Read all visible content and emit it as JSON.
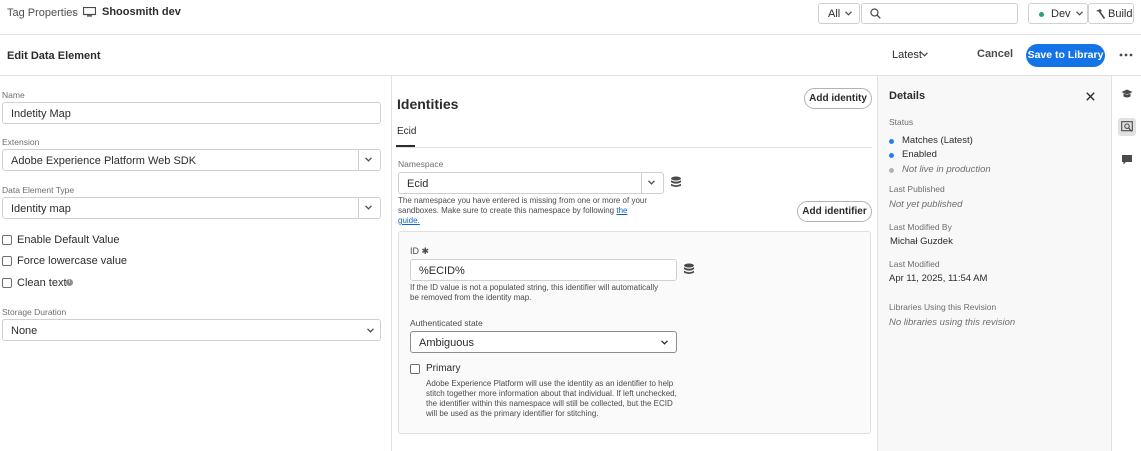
{
  "topbar": {
    "breadcrumb_root": "Tag Properties",
    "breadcrumb_sep": "›",
    "property_name": "Shoosmith dev",
    "scope_value": "All",
    "search_placeholder": "",
    "env_label": "Dev",
    "env_color": "#2d9d78",
    "build_label": "Build"
  },
  "header": {
    "title": "Edit Data Element",
    "version_label": "Latest",
    "cancel_label": "Cancel",
    "save_label": "Save to Library",
    "accent": "#1473e6"
  },
  "left": {
    "name_label": "Name",
    "name_value": "Indetity Map",
    "extension_label": "Extension",
    "extension_value": "Adobe Experience Platform Web SDK",
    "type_label": "Data Element Type",
    "type_value": "Identity map",
    "checkboxes": [
      {
        "label": "Enable Default Value",
        "checked": false
      },
      {
        "label": "Force lowercase value",
        "checked": false
      },
      {
        "label": "Clean text",
        "checked": false
      }
    ],
    "storage_label": "Storage Duration",
    "storage_value": "None"
  },
  "middle": {
    "title": "Identities",
    "add_identity_label": "Add identity",
    "tab_label": "Ecid",
    "namespace_label": "Namespace",
    "namespace_value": "Ecid",
    "namespace_help": "The namespace you have entered is missing from one or more of your sandboxes. Make sure to create this namespace by following ",
    "namespace_help_link": "the guide.",
    "add_identifier_label": "Add identifier",
    "id_label": "ID ✱",
    "id_value": "%ECID%",
    "id_help": "If the ID value is not a populated string, this identifier will automatically be removed from the identity map.",
    "auth_label": "Authenticated state",
    "auth_value": "Ambiguous",
    "primary_label": "Primary",
    "primary_checked": false,
    "primary_help": "Adobe Experience Platform will use the identity as an identifier to help stitch together more information about that individual. If left unchecked, the identifier within this namespace will still be collected, but the ECID will be used as the primary identifier for stitching."
  },
  "details": {
    "title": "Details",
    "status_label": "Status",
    "statuses": [
      {
        "text": "Matches (Latest)",
        "color": "#2680eb",
        "italic": false
      },
      {
        "text": "Enabled",
        "color": "#2680eb",
        "italic": false
      },
      {
        "text": "Not live in production",
        "color": "#b3b3b3",
        "italic": true
      }
    ],
    "last_published_label": "Last Published",
    "last_published_value": "Not yet published",
    "modified_by_label": "Last Modified By",
    "modified_by_value": "Michał Guzdek",
    "last_modified_label": "Last Modified",
    "last_modified_value": "Apr 11, 2025, 11:54 AM",
    "libraries_label": "Libraries Using this Revision",
    "libraries_value": "No libraries using this revision"
  },
  "rail": {
    "items": [
      "learn-icon",
      "inspect-icon",
      "comment-icon"
    ]
  }
}
